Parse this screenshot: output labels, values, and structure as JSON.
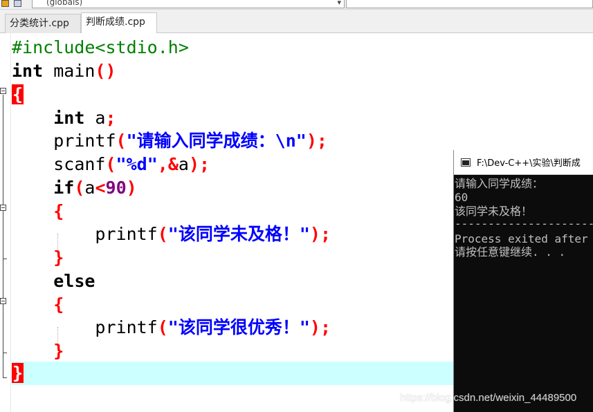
{
  "toolbar": {
    "scope_combo": "(globals)"
  },
  "tabs": [
    {
      "label": "分类统计.cpp"
    },
    {
      "label": "判断成绩.cpp"
    }
  ],
  "code": {
    "line1_include": "#include<stdio.h>",
    "line2_kw": "int",
    "line2_name": " main",
    "line2_parens": "()",
    "line3_brace": "{",
    "line4_kw": "int",
    "line4_var": " a",
    "line4_semi": ";",
    "line5_fn": "printf",
    "line5_open": "(",
    "line5_str": "\"请输入同学成绩：\\n\"",
    "line5_close": ");",
    "line6_fn": "scanf",
    "line6_open": "(",
    "line6_str": "\"%d\"",
    "line6_mid": ",&",
    "line6_var": "a",
    "line6_close": ");",
    "line7_kw": "if",
    "line7_open": "(",
    "line7_var": "a",
    "line7_op": "<",
    "line7_num": "90",
    "line7_close": ")",
    "line8_brace": "{",
    "line9_fn": "printf",
    "line9_open": "(",
    "line9_str": "\"该同学未及格！\"",
    "line9_close": ");",
    "line10_brace": "}",
    "line11_kw": "else",
    "line12_brace": "{",
    "line13_fn": "printf",
    "line13_open": "(",
    "line13_str": "\"该同学很优秀！\"",
    "line13_close": ");",
    "line14_brace": "}",
    "line15_brace": "}"
  },
  "console": {
    "title": "F:\\Dev-C++\\实验\\判断成",
    "lines": [
      "请输入同学成绩：",
      "60",
      "该同学未及格！",
      "----------------------",
      "Process exited after",
      "请按任意键继续. . ."
    ]
  },
  "watermark": "https://blog.csdn.net/weixin_44489500",
  "colors": {
    "keyword": "#000000",
    "preprocessor": "#008000",
    "symbol": "#ff0000",
    "string": "#0000ff",
    "number": "#800080",
    "current_line": "#ccffff",
    "console_bg": "#0c0c0c"
  }
}
